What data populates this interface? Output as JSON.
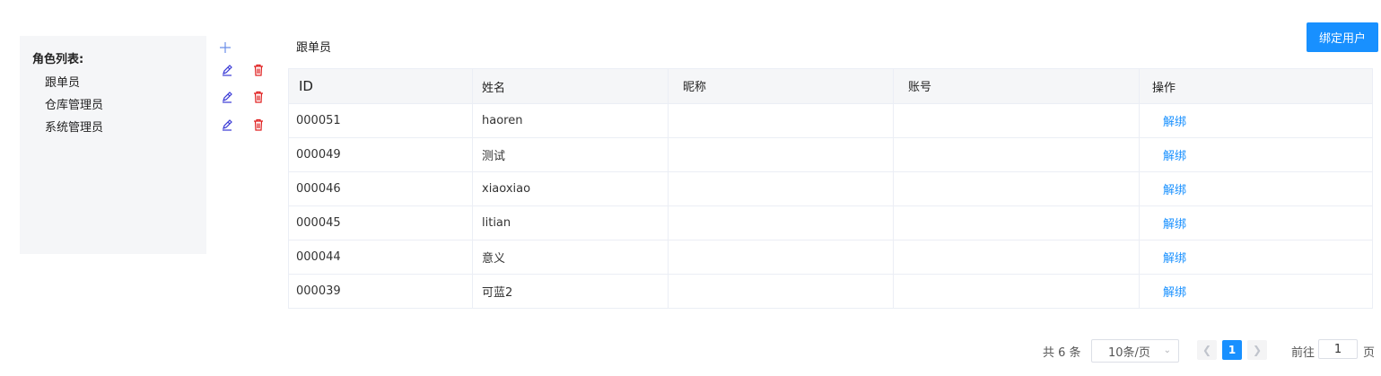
{
  "roles": {
    "title": "角色列表:",
    "items": [
      "跟单员",
      "仓库管理员",
      "系统管理员"
    ],
    "add_icon": "plus-icon",
    "edit_icon": "edit-icon",
    "delete_icon": "trash-icon"
  },
  "current_role": "跟单员",
  "bind_button": "绑定用户",
  "table": {
    "headers": [
      "ID",
      "姓名",
      "昵称",
      "账号",
      "操作"
    ],
    "rows": [
      {
        "id": "000051",
        "name": "haoren",
        "nickname": "",
        "account": "",
        "action": "解绑"
      },
      {
        "id": "000049",
        "name": "测试",
        "nickname": "",
        "account": "",
        "action": "解绑"
      },
      {
        "id": "000046",
        "name": "xiaoxiao",
        "nickname": "",
        "account": "",
        "action": "解绑"
      },
      {
        "id": "000045",
        "name": "litian",
        "nickname": "",
        "account": "",
        "action": "解绑"
      },
      {
        "id": "000044",
        "name": "意义",
        "nickname": "",
        "account": "",
        "action": "解绑"
      },
      {
        "id": "000039",
        "name": "可蓝2",
        "nickname": "",
        "account": "",
        "action": "解绑"
      }
    ]
  },
  "pagination": {
    "total_text": "共 6 条",
    "page_size": "10条/页",
    "prev_icon": "chevron-left-icon",
    "next_icon": "chevron-right-icon",
    "current_page": "1",
    "goto_label": "前往",
    "goto_value": "1",
    "page_suffix": "页"
  },
  "colors": {
    "accent": "#1890ff",
    "danger": "#e02020",
    "edit": "#3a3ad6"
  }
}
